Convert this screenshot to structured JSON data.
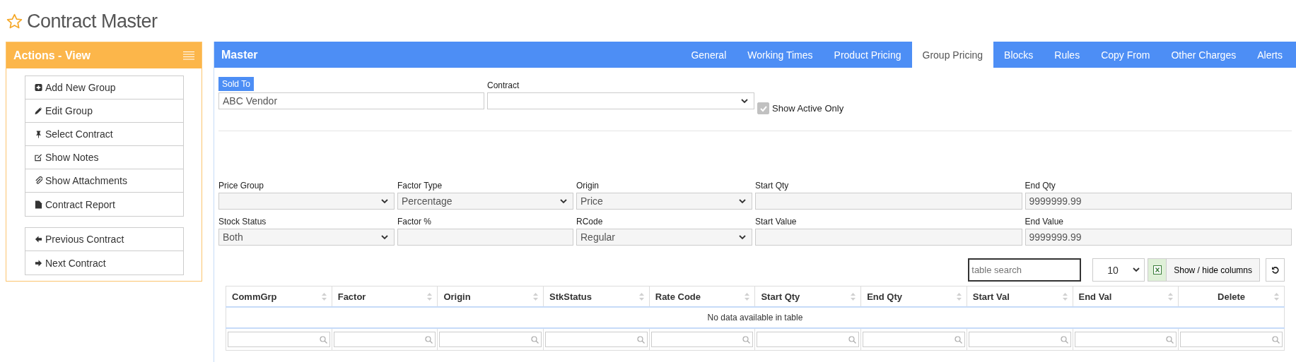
{
  "page_title": "Contract Master",
  "actions": {
    "title": "Actions - View",
    "groups": [
      [
        "Add New Group",
        "Edit Group",
        "Select Contract",
        "Show Notes",
        "Show Attachments",
        "Contract Report"
      ],
      [
        "Previous Contract",
        "Next Contract"
      ]
    ]
  },
  "master": {
    "title": "Master",
    "tabs": [
      {
        "label": "General",
        "selected": false
      },
      {
        "label": "Working Times",
        "selected": false
      },
      {
        "label": "Product Pricing",
        "selected": false
      },
      {
        "label": "Group Pricing",
        "selected": true
      },
      {
        "label": "Blocks",
        "selected": false
      },
      {
        "label": "Rules",
        "selected": false
      },
      {
        "label": "Copy From",
        "selected": false
      },
      {
        "label": "Other Charges",
        "selected": false
      },
      {
        "label": "Alerts",
        "selected": false
      }
    ]
  },
  "sold_to": {
    "label": "Sold To",
    "value": "ABC Vendor"
  },
  "contract": {
    "label": "Contract"
  },
  "show_active_only": {
    "label": "Show Active Only",
    "checked": true,
    "disabled": true
  },
  "filters": [
    {
      "label": "Price Group",
      "kind": "select"
    },
    {
      "label": "Factor Type",
      "kind": "select",
      "value": "Percentage"
    },
    {
      "label": "Origin",
      "kind": "select",
      "value": "Price"
    },
    {
      "label": "Start Qty",
      "kind": "input"
    },
    {
      "label": "End Qty",
      "kind": "input",
      "value": "9999999.99"
    },
    {
      "label": "Stock Status",
      "kind": "select",
      "value": "Both"
    },
    {
      "label": "Factor %",
      "kind": "input"
    },
    {
      "label": "RCode",
      "kind": "select",
      "value": "Regular"
    },
    {
      "label": "Start Value",
      "kind": "input"
    },
    {
      "label": "End Value",
      "kind": "input",
      "value": "9999999.99"
    }
  ],
  "table_tools": {
    "search_placeholder": "table search",
    "page_length": "10",
    "columns_button": "Show / hide columns"
  },
  "table": {
    "columns": [
      "CommGrp",
      "Factor",
      "Origin",
      "StkStatus",
      "Rate Code",
      "Start Qty",
      "End Qty",
      "Start Val",
      "End Val",
      "Delete"
    ],
    "empty_message": "No data available in table"
  }
}
